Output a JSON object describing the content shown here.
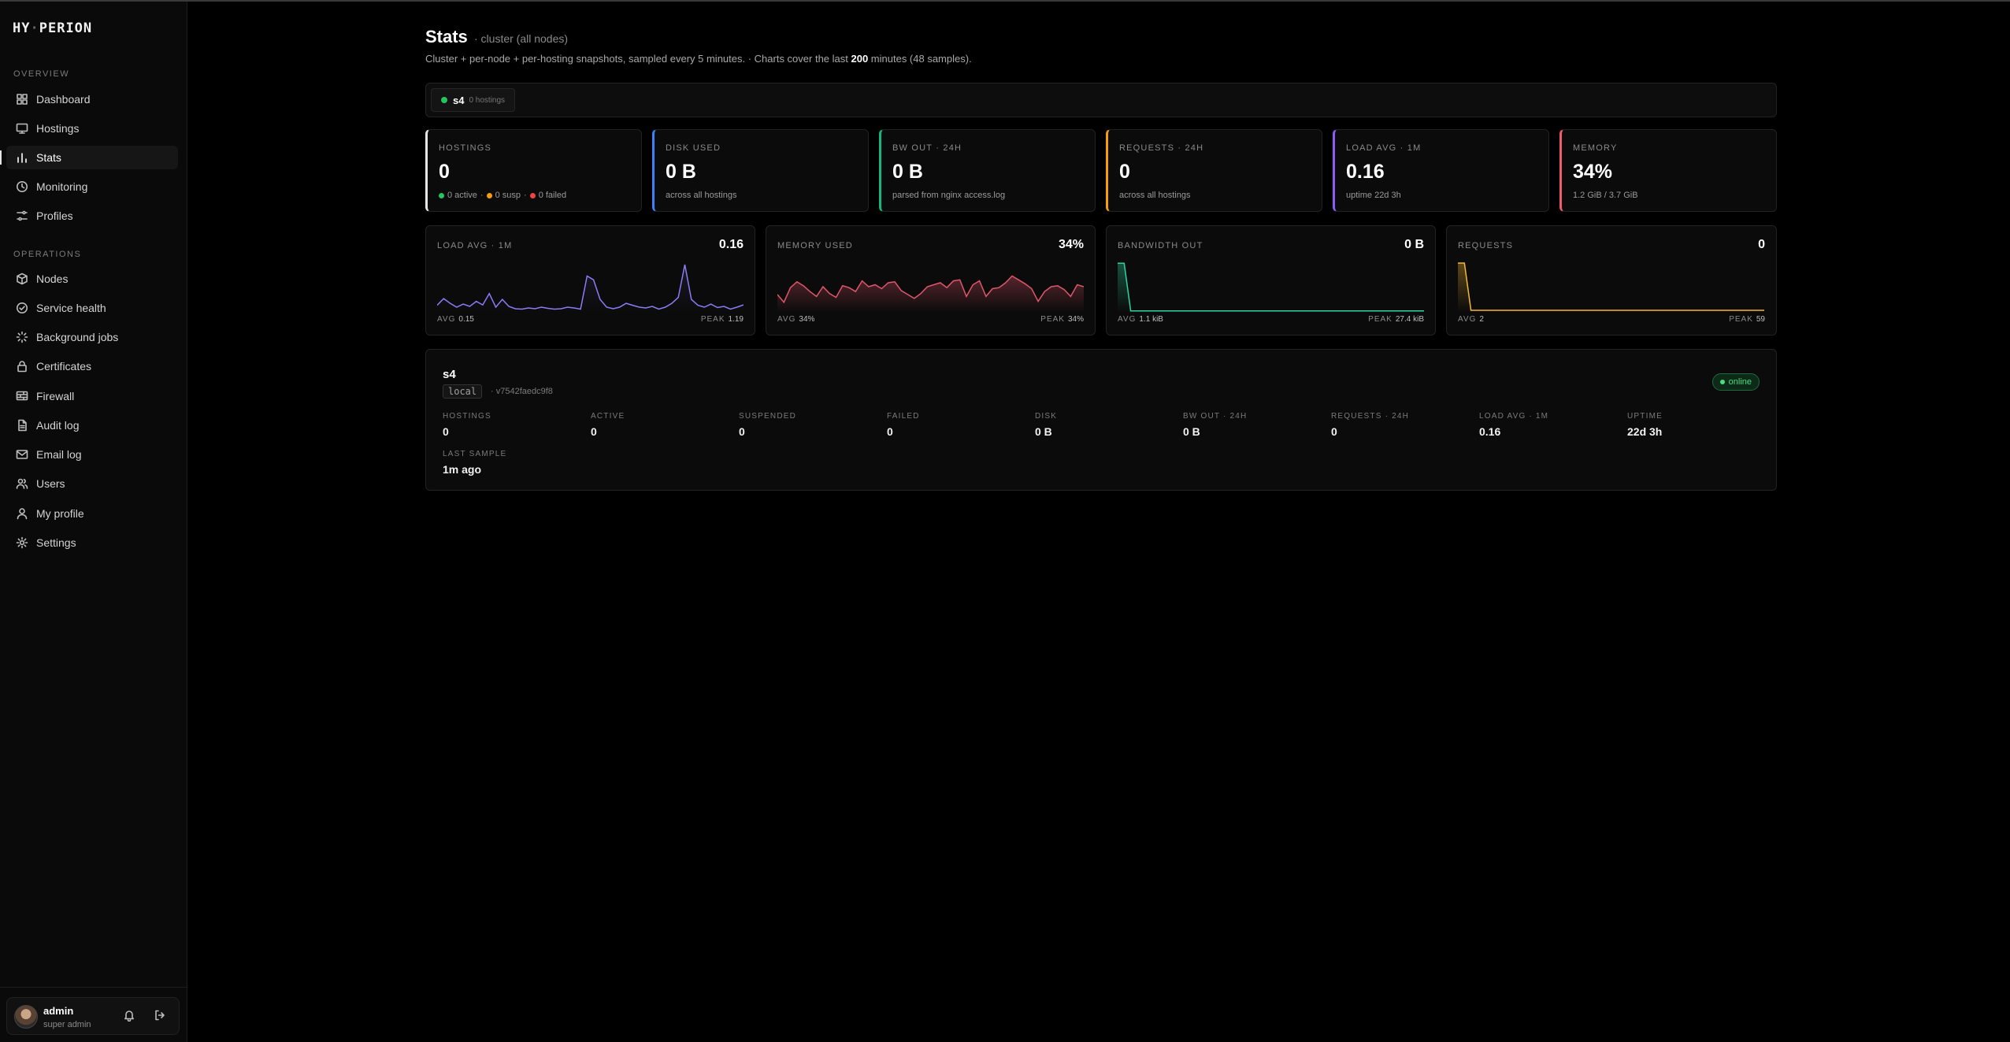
{
  "app": {
    "logo_left": "HY",
    "logo_dot": "·",
    "logo_right": "PERION"
  },
  "sidebar": {
    "overview_title": "OVERVIEW",
    "operations_title": "OPERATIONS",
    "items": [
      {
        "label": "Dashboard",
        "icon": "grid-icon"
      },
      {
        "label": "Hostings",
        "icon": "monitor-icon"
      },
      {
        "label": "Stats",
        "icon": "bar-chart-icon"
      },
      {
        "label": "Monitoring",
        "icon": "clock-icon"
      },
      {
        "label": "Profiles",
        "icon": "sliders-icon"
      },
      {
        "label": "Nodes",
        "icon": "box-icon"
      },
      {
        "label": "Service health",
        "icon": "check-circle-icon"
      },
      {
        "label": "Background jobs",
        "icon": "loader-icon"
      },
      {
        "label": "Certificates",
        "icon": "lock-icon"
      },
      {
        "label": "Firewall",
        "icon": "firewall-icon"
      },
      {
        "label": "Audit log",
        "icon": "file-text-icon"
      },
      {
        "label": "Email log",
        "icon": "mail-icon"
      },
      {
        "label": "Users",
        "icon": "users-icon"
      },
      {
        "label": "My profile",
        "icon": "user-icon"
      },
      {
        "label": "Settings",
        "icon": "gear-icon"
      }
    ],
    "user": {
      "name": "admin",
      "role": "super admin"
    }
  },
  "header": {
    "title": "Stats",
    "subtitle": "· cluster (all nodes)",
    "desc_1": "Cluster + per-node + per-hosting snapshots, sampled every 5 minutes. · Charts cover the last ",
    "desc_minutes": "200",
    "desc_2": " minutes (48 samples)."
  },
  "node_selector": {
    "name": "s4",
    "count": "0 hostings"
  },
  "kpis": [
    {
      "label": "HOSTINGS",
      "value": "0",
      "active": "0 active",
      "susp": "0 susp",
      "failed": "0 failed",
      "sep": "·",
      "color": "#e6e6e6"
    },
    {
      "label": "DISK USED",
      "value": "0 B",
      "sub": "across all hostings",
      "color": "#3b82f6"
    },
    {
      "label": "BW OUT · 24H",
      "value": "0 B",
      "sub": "parsed from nginx access.log",
      "color": "#10b981"
    },
    {
      "label": "REQUESTS · 24H",
      "value": "0",
      "sub": "across all hostings",
      "color": "#f59e0b"
    },
    {
      "label": "LOAD AVG · 1M",
      "value": "0.16",
      "sub": "uptime 22d 3h",
      "color": "#8b5cf6"
    },
    {
      "label": "MEMORY",
      "value": "34%",
      "sub": "1.2 GiB / 3.7 GiB",
      "color": "#f05a6a"
    }
  ],
  "charts": [
    {
      "label": "LOAD AVG · 1M",
      "value": "0.16",
      "avg_label": "AVG",
      "avg": "0.15",
      "peak_label": "PEAK",
      "peak": "1.19",
      "color": "#8b7cf6"
    },
    {
      "label": "MEMORY USED",
      "value": "34%",
      "avg_label": "AVG",
      "avg": "34%",
      "peak_label": "PEAK",
      "peak": "34%",
      "color": "#e0566a"
    },
    {
      "label": "BANDWIDTH OUT",
      "value": "0 B",
      "avg_label": "AVG",
      "avg": "1.1 kiB",
      "peak_label": "PEAK",
      "peak": "27.4 kiB",
      "color": "#2dd4a0"
    },
    {
      "label": "REQUESTS",
      "value": "0",
      "avg_label": "AVG",
      "avg": "2",
      "peak_label": "PEAK",
      "peak": "59",
      "color": "#f5b731"
    }
  ],
  "chart_data": [
    {
      "type": "line",
      "title": "LOAD AVG · 1M",
      "values": [
        0.15,
        0.32,
        0.2,
        0.1,
        0.18,
        0.12,
        0.25,
        0.16,
        0.45,
        0.1,
        0.3,
        0.12,
        0.06,
        0.05,
        0.08,
        0.06,
        0.1,
        0.07,
        0.05,
        0.06,
        0.1,
        0.08,
        0.05,
        0.9,
        0.8,
        0.3,
        0.1,
        0.06,
        0.1,
        0.2,
        0.15,
        0.1,
        0.08,
        0.12,
        0.05,
        0.1,
        0.2,
        0.35,
        1.19,
        0.3,
        0.15,
        0.1,
        0.18,
        0.09,
        0.12,
        0.05,
        0.1,
        0.16
      ],
      "ylim": [
        0,
        1.25
      ]
    },
    {
      "type": "area",
      "title": "MEMORY USED",
      "values": [
        34,
        18,
        48,
        60,
        52,
        40,
        30,
        50,
        36,
        28,
        52,
        48,
        40,
        62,
        50,
        54,
        46,
        58,
        60,
        42,
        34,
        26,
        36,
        50,
        54,
        58,
        48,
        62,
        64,
        30,
        54,
        62,
        30,
        46,
        48,
        58,
        72,
        64,
        56,
        46,
        20,
        40,
        50,
        52,
        44,
        30,
        54,
        50
      ],
      "ylim": [
        0,
        100
      ]
    },
    {
      "type": "area",
      "title": "BANDWIDTH OUT",
      "values": [
        27.4,
        27.4,
        0.1,
        0.1,
        0.1,
        0.1,
        0.1,
        0.1,
        0.1,
        0.1,
        0.1,
        0.1,
        0.1,
        0.1,
        0.1,
        0.1,
        0.1,
        0.1,
        0.1,
        0.1,
        0.1,
        0.1,
        0.1,
        0.1,
        0.1,
        0.1,
        0.1,
        0.1,
        0.1,
        0.1,
        0.1,
        0.1,
        0.1,
        0.1,
        0.1,
        0.1,
        0.1,
        0.1,
        0.1,
        0.1,
        0.1,
        0.1,
        0.1,
        0.1,
        0.1,
        0.1,
        0.1,
        0.1
      ],
      "ylim": [
        0,
        28
      ]
    },
    {
      "type": "area",
      "title": "REQUESTS",
      "values": [
        59,
        59,
        1,
        1,
        1,
        1,
        1,
        1,
        1,
        1,
        1,
        1,
        1,
        1,
        1,
        1,
        1,
        1,
        1,
        1,
        1,
        1,
        1,
        1,
        1,
        1,
        1,
        1,
        1,
        1,
        1,
        1,
        1,
        1,
        1,
        1,
        1,
        1,
        1,
        1,
        1,
        1,
        1,
        1,
        1,
        1,
        1,
        1
      ],
      "ylim": [
        0,
        60
      ]
    }
  ],
  "node_card": {
    "name": "s4",
    "tag": "local",
    "version": "· v7542faedc9f8",
    "status": "online",
    "metrics": [
      {
        "label": "HOSTINGS",
        "value": "0"
      },
      {
        "label": "ACTIVE",
        "value": "0"
      },
      {
        "label": "SUSPENDED",
        "value": "0"
      },
      {
        "label": "FAILED",
        "value": "0"
      },
      {
        "label": "DISK",
        "value": "0 B"
      },
      {
        "label": "BW OUT · 24H",
        "value": "0 B"
      },
      {
        "label": "REQUESTS · 24H",
        "value": "0"
      },
      {
        "label": "LOAD AVG · 1M",
        "value": "0.16"
      },
      {
        "label": "UPTIME",
        "value": "22d 3h"
      }
    ],
    "last_sample_label": "LAST SAMPLE",
    "last_sample_value": "1m ago"
  }
}
